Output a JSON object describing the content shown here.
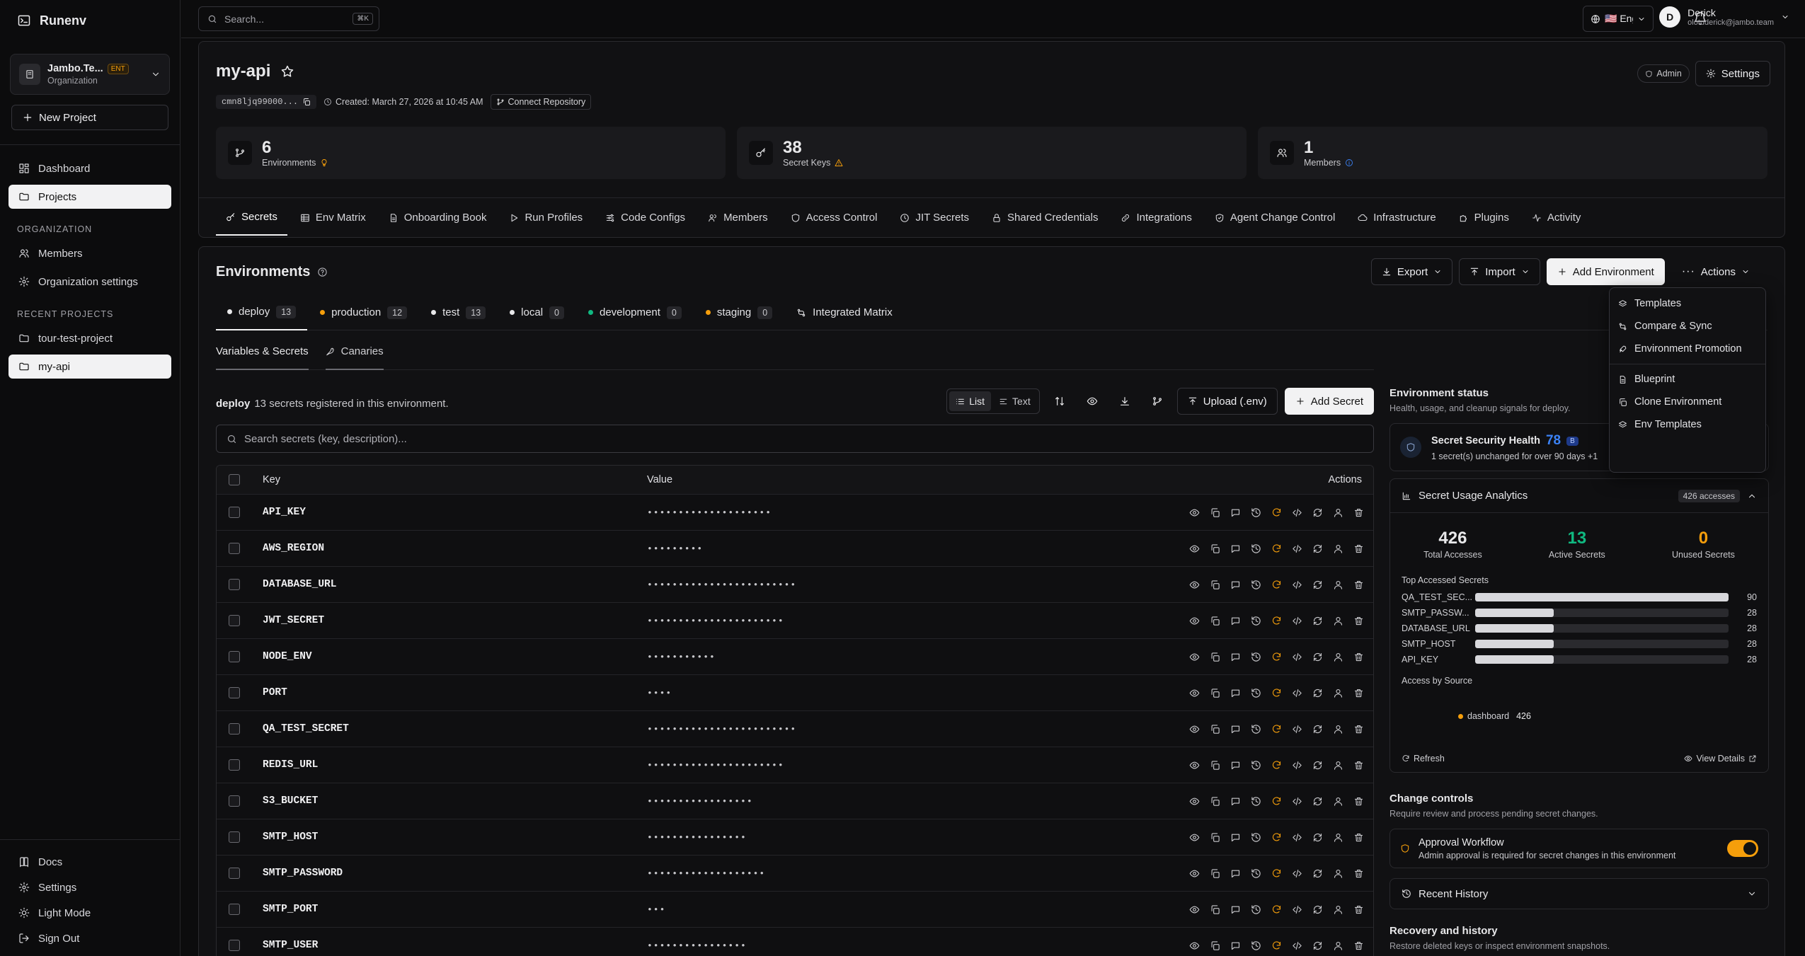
{
  "app": {
    "name": "Runenv"
  },
  "org": {
    "name": "Jambo.Te...",
    "type": "Organization",
    "badge": "ENT"
  },
  "sidebar": {
    "new_project": "New Project",
    "main_items": [
      {
        "label": "Dashboard"
      },
      {
        "label": "Projects"
      }
    ],
    "org_heading": "ORGANIZATION",
    "org_items": [
      {
        "label": "Members"
      },
      {
        "label": "Organization settings"
      }
    ],
    "recent_heading": "RECENT PROJECTS",
    "recent_items": [
      {
        "label": "tour-test-project"
      },
      {
        "label": "my-api"
      }
    ],
    "footer_items": [
      {
        "label": "Docs"
      },
      {
        "label": "Settings"
      },
      {
        "label": "Light Mode"
      },
      {
        "label": "Sign Out"
      }
    ]
  },
  "topbar": {
    "search_placeholder": "Search...",
    "search_kbd": "⌘K",
    "language": "🇺🇸 Englisl",
    "user": {
      "initial": "D",
      "name": "Derick",
      "email": "olotuderick@jambo.team"
    }
  },
  "project": {
    "name": "my-api",
    "id": "cmn8ljq99000...",
    "created": "Created: March 27, 2026 at 10:45 AM",
    "connect_repo": "Connect Repository",
    "role": "Admin",
    "settings": "Settings"
  },
  "stats": [
    {
      "value": "6",
      "label": "Environments"
    },
    {
      "value": "38",
      "label": "Secret Keys"
    },
    {
      "value": "1",
      "label": "Members"
    }
  ],
  "tabs": [
    {
      "label": "Secrets"
    },
    {
      "label": "Env Matrix"
    },
    {
      "label": "Onboarding Book"
    },
    {
      "label": "Run Profiles"
    },
    {
      "label": "Code Configs"
    },
    {
      "label": "Members"
    },
    {
      "label": "Access Control"
    },
    {
      "label": "JIT Secrets"
    },
    {
      "label": "Shared Credentials"
    },
    {
      "label": "Integrations"
    },
    {
      "label": "Agent Change Control"
    },
    {
      "label": "Infrastructure"
    },
    {
      "label": "Plugins"
    },
    {
      "label": "Activity"
    }
  ],
  "environments": {
    "title": "Environments",
    "export": "Export",
    "import": "Import",
    "add": "Add Environment",
    "actions": "Actions",
    "envs": [
      {
        "name": "deploy",
        "count": "13",
        "color": "#e8e8ea"
      },
      {
        "name": "production",
        "count": "12",
        "color": "#f59e0b"
      },
      {
        "name": "test",
        "count": "13",
        "color": "#e8e8ea"
      },
      {
        "name": "local",
        "count": "0",
        "color": "#e8e8ea"
      },
      {
        "name": "development",
        "count": "0",
        "color": "#10b981"
      },
      {
        "name": "staging",
        "count": "0",
        "color": "#f59e0b"
      }
    ],
    "integrated": "Integrated Matrix",
    "subtabs": [
      {
        "label": "Variables & Secrets"
      },
      {
        "label": "Canaries"
      }
    ]
  },
  "actions_menu": [
    {
      "label": "Templates"
    },
    {
      "label": "Compare & Sync"
    },
    {
      "label": "Environment Promotion"
    },
    {
      "label": "Blueprint"
    },
    {
      "label": "Clone Environment"
    },
    {
      "label": "Env Templates"
    }
  ],
  "secrets": {
    "env": "deploy",
    "summary": "13 secrets registered in this environment.",
    "view_list": "List",
    "view_text": "Text",
    "upload": "Upload (.env)",
    "add": "Add Secret",
    "search_placeholder": "Search secrets (key, description)...",
    "headers": {
      "key": "Key",
      "value": "Value",
      "actions": "Actions"
    },
    "rows": [
      {
        "key": "API_KEY",
        "value": "••••••••••••••••••••"
      },
      {
        "key": "AWS_REGION",
        "value": "•••••••••"
      },
      {
        "key": "DATABASE_URL",
        "value": "••••••••••••••••••••••••"
      },
      {
        "key": "JWT_SECRET",
        "value": "••••••••••••••••••••••"
      },
      {
        "key": "NODE_ENV",
        "value": "•••••••••••"
      },
      {
        "key": "PORT",
        "value": "••••"
      },
      {
        "key": "QA_TEST_SECRET",
        "value": "••••••••••••••••••••••••"
      },
      {
        "key": "REDIS_URL",
        "value": "••••••••••••••••••••••"
      },
      {
        "key": "S3_BUCKET",
        "value": "•••••••••••••••••"
      },
      {
        "key": "SMTP_HOST",
        "value": "••••••••••••••••"
      },
      {
        "key": "SMTP_PASSWORD",
        "value": "•••••••••••••••••••"
      },
      {
        "key": "SMTP_PORT",
        "value": "•••"
      },
      {
        "key": "SMTP_USER",
        "value": "••••••••••••••••"
      }
    ]
  },
  "status": {
    "title": "Environment status",
    "subtitle": "Health, usage, and cleanup signals for deploy.",
    "health": {
      "title": "Secret Security Health",
      "score": "78",
      "grade": "B",
      "note": "1 secret(s) unchanged for over 90 days +1"
    },
    "usage": {
      "title": "Secret Usage Analytics",
      "badge": "426 accesses",
      "total": "426",
      "total_label": "Total Accesses",
      "active": "13",
      "active_label": "Active Secrets",
      "unused": "0",
      "unused_label": "Unused Secrets",
      "top_heading": "Top Accessed Secrets",
      "top": [
        {
          "name": "QA_TEST_SEC...",
          "count": "90",
          "frac": 1.0
        },
        {
          "name": "SMTP_PASSW...",
          "count": "28",
          "frac": 0.31
        },
        {
          "name": "DATABASE_URL",
          "count": "28",
          "frac": 0.31
        },
        {
          "name": "SMTP_HOST",
          "count": "28",
          "frac": 0.31
        },
        {
          "name": "API_KEY",
          "count": "28",
          "frac": 0.31
        }
      ],
      "source_heading": "Access by Source",
      "source": {
        "name": "dashboard",
        "count": "426"
      },
      "refresh": "Refresh",
      "view_details": "View Details"
    },
    "change": {
      "title": "Change controls",
      "subtitle": "Require review and process pending secret changes.",
      "approval": "Approval Workflow",
      "approval_note": "Admin approval is required for secret changes in this environment"
    },
    "history": "Recent History",
    "recovery": {
      "title": "Recovery and history",
      "subtitle": "Restore deleted keys or inspect environment snapshots."
    }
  },
  "colors": {
    "accent_orange": "#f59e0b",
    "active_green": "#10b981",
    "score_blue": "#3b82f6"
  }
}
